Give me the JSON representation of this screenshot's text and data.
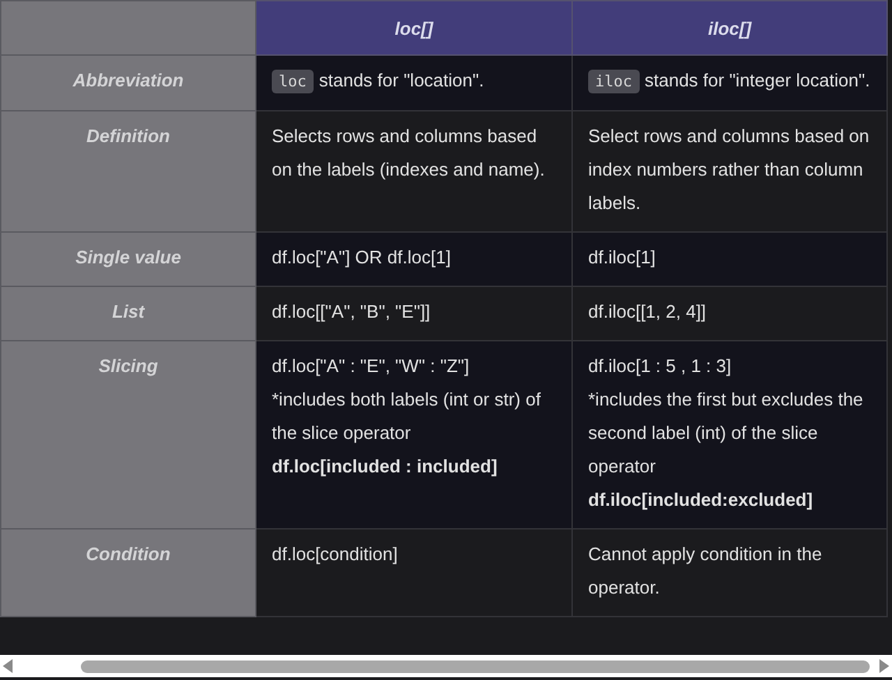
{
  "table": {
    "columns": [
      "loc[]",
      "iloc[]"
    ],
    "rows": [
      {
        "label": "Abbreviation",
        "cells": [
          {
            "lines": [
              {
                "kind": "code",
                "code": "loc",
                "text": "stands for \"location\"."
              }
            ]
          },
          {
            "lines": [
              {
                "kind": "code",
                "code": "iloc",
                "text": "stands for \"integer location\"."
              }
            ]
          }
        ]
      },
      {
        "label": "Definition",
        "cells": [
          {
            "lines": [
              {
                "kind": "plain",
                "text": "Selects rows and columns based on the labels (indexes and name)."
              }
            ]
          },
          {
            "lines": [
              {
                "kind": "plain",
                "text": "Select rows and columns based on index numbers rather than column labels."
              }
            ]
          }
        ]
      },
      {
        "label": "Single value",
        "cells": [
          {
            "lines": [
              {
                "kind": "plain",
                "text": "df.loc[\"A\"] OR df.loc[1]"
              }
            ]
          },
          {
            "lines": [
              {
                "kind": "plain",
                "text": "df.iloc[1]"
              }
            ]
          }
        ]
      },
      {
        "label": "List",
        "cells": [
          {
            "lines": [
              {
                "kind": "plain",
                "text": "df.loc[[\"A\", \"B\", \"E\"]]"
              }
            ]
          },
          {
            "lines": [
              {
                "kind": "plain",
                "text": "df.iloc[[1, 2, 4]]"
              }
            ]
          }
        ]
      },
      {
        "label": "Slicing",
        "cells": [
          {
            "lines": [
              {
                "kind": "plain",
                "text": "df.loc[\"A\" : \"E\", \"W\" : \"Z\"]"
              },
              {
                "kind": "plain",
                "text": "*includes both labels (int or str) of the slice operator"
              },
              {
                "kind": "bold",
                "text": "df.loc[included : included]"
              }
            ]
          },
          {
            "lines": [
              {
                "kind": "plain",
                "text": "df.iloc[1 : 5 , 1 : 3]"
              },
              {
                "kind": "plain",
                "text": "*includes the first but excludes the second label (int) of the slice operator"
              },
              {
                "kind": "bold",
                "text": "df.iloc[included:excluded]"
              }
            ]
          }
        ]
      },
      {
        "label": "Condition",
        "cells": [
          {
            "lines": [
              {
                "kind": "plain",
                "text": "df.loc[condition]"
              }
            ]
          },
          {
            "lines": [
              {
                "kind": "plain",
                "text": "Cannot apply condition in the operator."
              }
            ]
          }
        ]
      }
    ]
  }
}
